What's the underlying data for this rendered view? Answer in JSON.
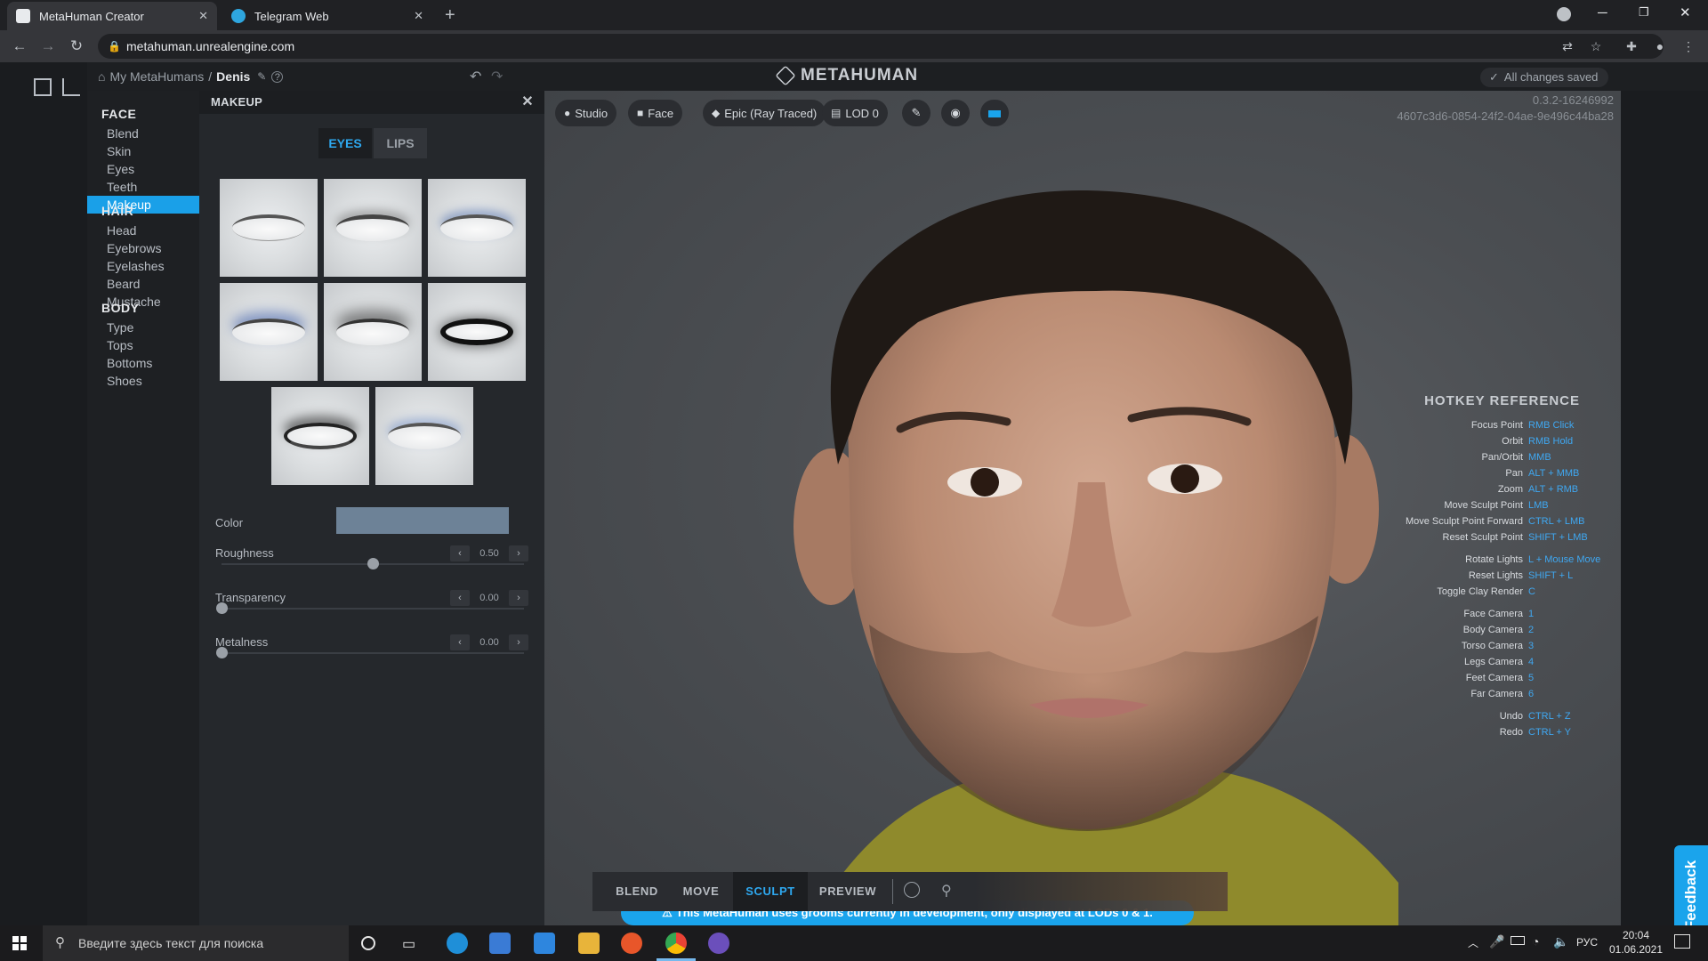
{
  "browser": {
    "tabs": [
      {
        "title": "MetaHuman Creator",
        "active": true
      },
      {
        "title": "Telegram Web",
        "active": false
      }
    ],
    "new_tab": "+",
    "url": "metahuman.unrealengine.com"
  },
  "app": {
    "breadcrumb": {
      "root": "My MetaHumans",
      "separator": "/",
      "current": "Denis"
    },
    "logo": "METAHUMAN",
    "save_status": "All changes saved",
    "version": "0.3.2-16246992",
    "session_id": "4607c3d6-0854-24f2-04ae-9e496c44ba28"
  },
  "sidebar": {
    "sections": [
      {
        "title": "FACE",
        "items": [
          "Blend",
          "Skin",
          "Eyes",
          "Teeth",
          "Makeup"
        ]
      },
      {
        "title": "HAIR",
        "items": [
          "Head",
          "Eyebrows",
          "Eyelashes",
          "Beard",
          "Mustache"
        ]
      },
      {
        "title": "BODY",
        "items": [
          "Type",
          "Tops",
          "Bottoms",
          "Shoes"
        ]
      }
    ],
    "active_item": "Makeup"
  },
  "panel": {
    "title": "MAKEUP",
    "tabs": [
      "EYES",
      "LIPS"
    ],
    "active_tab": "EYES",
    "color_label": "Color",
    "color_value": "#6d8297",
    "params": [
      {
        "label": "Roughness",
        "value": "0.50",
        "level": 0.5
      },
      {
        "label": "Transparency",
        "value": "0.00",
        "level": 0.0
      },
      {
        "label": "Metalness",
        "value": "0.00",
        "level": 0.0
      }
    ]
  },
  "viewport": {
    "toolbar": [
      {
        "label": "Studio",
        "icon": "lightbulb-icon"
      },
      {
        "label": "Face",
        "icon": "camera-icon"
      },
      {
        "label": "Epic (Ray Traced)",
        "icon": "diamond-icon"
      },
      {
        "label": "LOD 0",
        "icon": "layers-icon"
      }
    ],
    "hotkey_title": "HOTKEY REFERENCE",
    "hotkeys": [
      {
        "action": "Focus Point",
        "key": "RMB Click"
      },
      {
        "action": "Orbit",
        "key": "RMB Hold"
      },
      {
        "action": "Pan/Orbit",
        "key": "MMB"
      },
      {
        "action": "Pan",
        "key": "ALT + MMB"
      },
      {
        "action": "Zoom",
        "key": "ALT + RMB"
      },
      {
        "action": "Move Sculpt Point",
        "key": "LMB"
      },
      {
        "action": "Move Sculpt Point Forward",
        "key": "CTRL + LMB"
      },
      {
        "action": "Reset Sculpt Point",
        "key": "SHIFT + LMB"
      },
      {
        "action": "Rotate Lights",
        "key": "L + Mouse Move"
      },
      {
        "action": "Reset Lights",
        "key": "SHIFT + L"
      },
      {
        "action": "Toggle Clay Render",
        "key": "C"
      },
      {
        "action": "Face Camera",
        "key": "1"
      },
      {
        "action": "Body Camera",
        "key": "2"
      },
      {
        "action": "Torso Camera",
        "key": "3"
      },
      {
        "action": "Legs Camera",
        "key": "4"
      },
      {
        "action": "Feet Camera",
        "key": "5"
      },
      {
        "action": "Far Camera",
        "key": "6"
      },
      {
        "action": "Undo",
        "key": "CTRL + Z"
      },
      {
        "action": "Redo",
        "key": "CTRL + Y"
      }
    ],
    "notice": "This MetaHuman uses grooms currently in development, only displayed at LODs 0 & 1.",
    "modes": [
      "BLEND",
      "MOVE",
      "SCULPT",
      "PREVIEW"
    ],
    "active_mode": "SCULPT",
    "feedback": "Feedback"
  },
  "taskbar": {
    "search_placeholder": "Введите здесь текст для поиска",
    "language": "РУС",
    "time": "20:04",
    "date": "01.06.2021"
  },
  "colors": {
    "accent": "#1aa4ec",
    "hotkey_key": "#3fa8f2"
  }
}
